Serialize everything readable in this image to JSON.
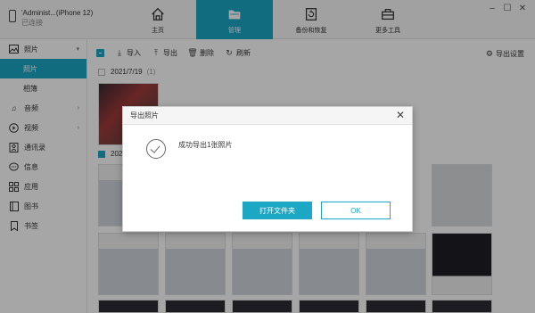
{
  "device": {
    "name": "'Administ...(iPhone 12)",
    "status": "已连接"
  },
  "nav": [
    {
      "label": "主页",
      "icon": "home-icon"
    },
    {
      "label": "管理",
      "icon": "folder-icon"
    },
    {
      "label": "备份和恢复",
      "icon": "backup-icon"
    },
    {
      "label": "更多工具",
      "icon": "toolbox-icon"
    }
  ],
  "window": {
    "minimize": "–",
    "maximize": "☐",
    "close": "✕"
  },
  "sidebar": {
    "items": [
      {
        "label": "照片",
        "icon": "photo-icon"
      },
      {
        "label": "照片",
        "sub": true
      },
      {
        "label": "相簿",
        "sub": true
      },
      {
        "label": "音频",
        "icon": "music-icon"
      },
      {
        "label": "视频",
        "icon": "video-icon"
      },
      {
        "label": "通讯录",
        "icon": "contacts-icon"
      },
      {
        "label": "信息",
        "icon": "message-icon"
      },
      {
        "label": "应用",
        "icon": "apps-icon"
      },
      {
        "label": "图书",
        "icon": "book-icon"
      },
      {
        "label": "书签",
        "icon": "bookmark-icon"
      }
    ]
  },
  "toolbar": {
    "import": "导入",
    "export": "导出",
    "delete": "删除",
    "refresh": "刷新",
    "export_settings": "导出设置"
  },
  "content": {
    "groups": [
      {
        "date": "2021/7/19",
        "count": "(1)"
      },
      {
        "date": "202"
      }
    ]
  },
  "dialog": {
    "title": "导出照片",
    "message": "成功导出1张照片",
    "open_folder": "打开文件夹",
    "ok": "OK"
  },
  "colors": {
    "accent": "#1ca7c4"
  }
}
